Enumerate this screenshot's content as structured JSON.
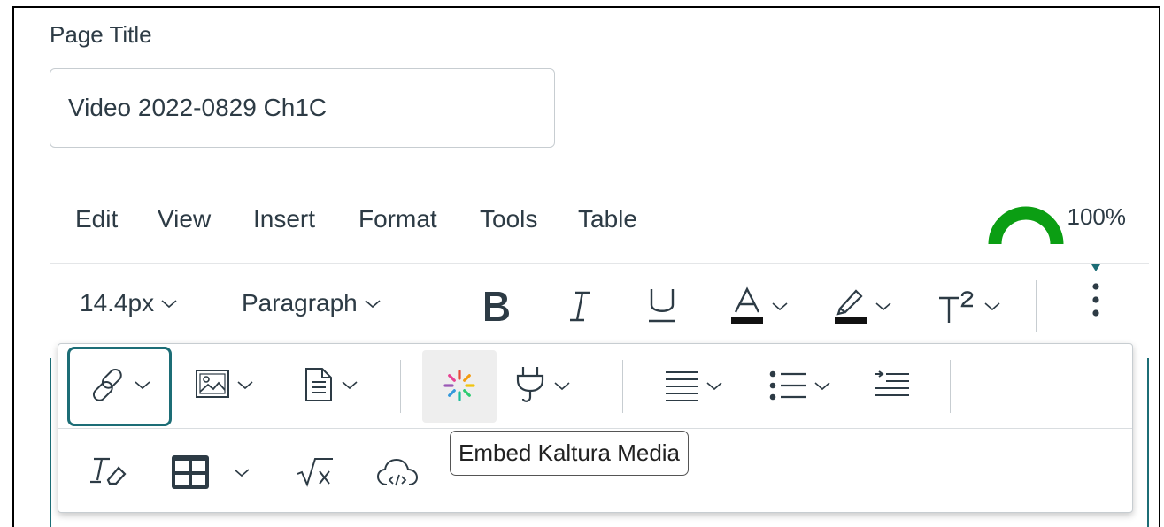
{
  "page_title": {
    "label": "Page Title",
    "value": "Video 2022-0829 Ch1C"
  },
  "menubar": {
    "items": [
      "Edit",
      "View",
      "Insert",
      "Format",
      "Tools",
      "Table"
    ],
    "accessibility_checker": {
      "percent": "100%",
      "icon": "gauge-icon",
      "color": "#0b9e13"
    }
  },
  "toolbar": {
    "font_size": "14.4px",
    "block_format": "Paragraph",
    "icons": [
      "bold-icon",
      "italic-icon",
      "underline-icon",
      "text-color-icon",
      "highlight-icon",
      "superscript-icon",
      "more-icon"
    ]
  },
  "overflow_toolbar": {
    "row1_icons": [
      "link-icon",
      "image-icon",
      "document-icon",
      "kaltura-icon",
      "plugin-icon",
      "align-icon",
      "bullet-list-icon",
      "indent-icon"
    ],
    "row2_icons": [
      "clear-formatting-icon",
      "table-icon",
      "equation-icon",
      "cloud-upload-icon"
    ]
  },
  "tooltip": {
    "text": "Embed Kaltura Media"
  },
  "colors": {
    "focus": "#1c6d76",
    "text": "#2d3b45"
  }
}
